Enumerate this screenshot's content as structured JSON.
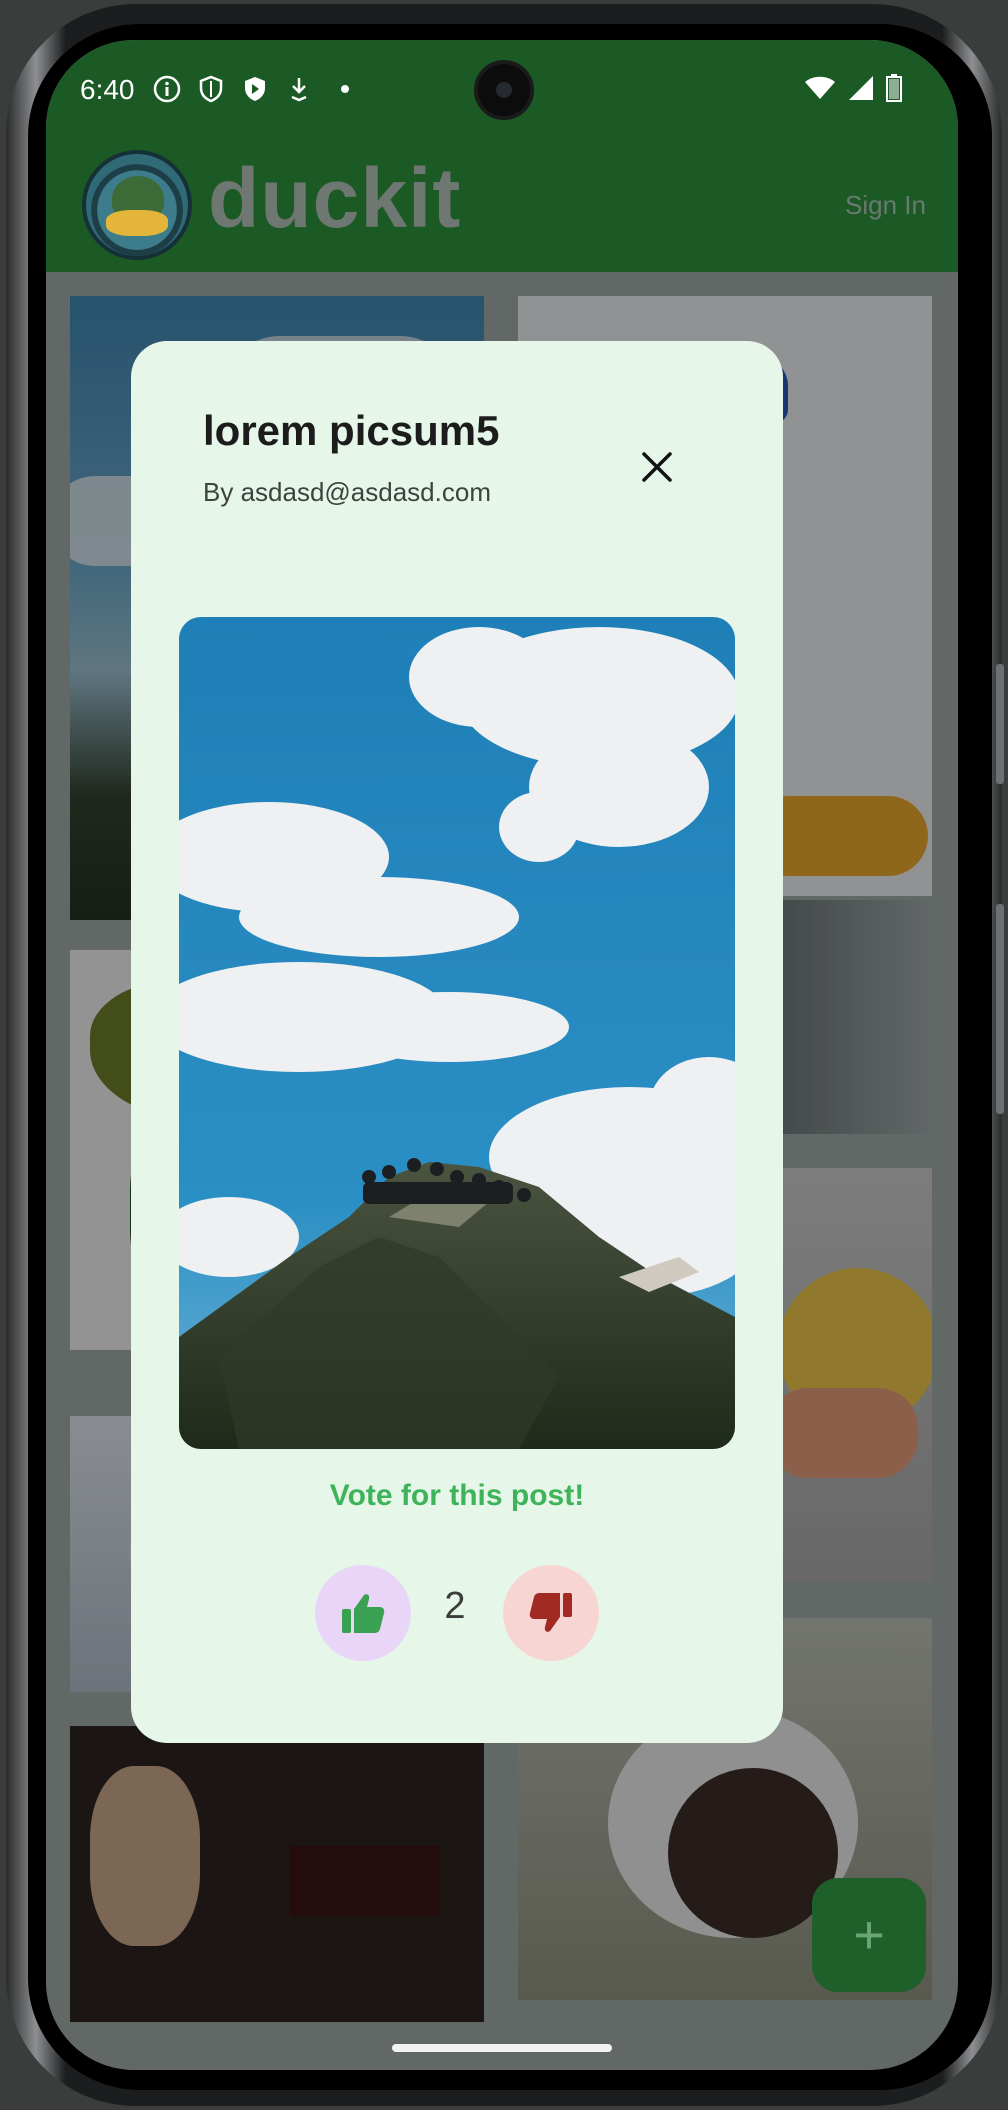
{
  "status_bar": {
    "time": "6:40",
    "icons": [
      "info-icon",
      "shield-icon",
      "shield-filled-icon",
      "download-icon",
      "dot-icon"
    ],
    "right_icons": [
      "wifi-icon",
      "signal-icon",
      "battery-icon"
    ]
  },
  "app_bar": {
    "logo_text": "duckit",
    "sign_in_label": "Sign In",
    "color": "#1b5a25"
  },
  "dialog": {
    "title": "lorem picsum5",
    "author": "By asdasd@asdasd.com",
    "close_icon": "close-icon",
    "vote_prompt": "Vote for this post!",
    "vote_count": "2",
    "upvote_icon": "thumb-up-icon",
    "downvote_icon": "thumb-down-icon",
    "accent": "#3fb35a"
  },
  "fab": {
    "label": "+",
    "icon": "plus-icon"
  }
}
